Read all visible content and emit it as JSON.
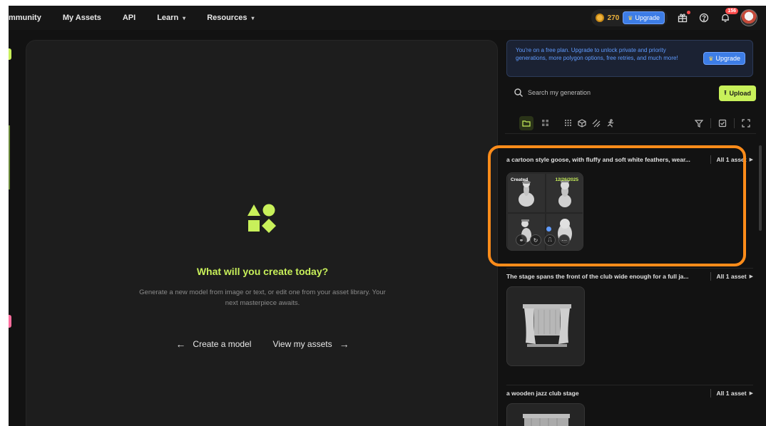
{
  "nav": {
    "items": [
      {
        "label": "mmunity",
        "has_caret": false
      },
      {
        "label": "My Assets",
        "has_caret": false
      },
      {
        "label": "API",
        "has_caret": false
      },
      {
        "label": "Learn",
        "has_caret": true
      },
      {
        "label": "Resources",
        "has_caret": true
      }
    ],
    "caret_glyph": "▾",
    "credits": "270",
    "upgrade_label": "Upgrade",
    "notification_badge": "156",
    "icons": [
      "coin-icon",
      "crown-icon",
      "gift-icon",
      "help-icon",
      "bell-icon",
      "avatar"
    ]
  },
  "hero": {
    "title": "What will you create today?",
    "subtitle": "Generate a new model from image or text, or edit one from your asset library. Your next masterpiece awaits.",
    "create_label": "Create a model",
    "view_label": "View my assets"
  },
  "promo": {
    "text": "You're on a free plan. Upgrade to unlock private and priority generations, more polygon options, free retries, and much more!",
    "button_label": "Upgrade"
  },
  "search": {
    "placeholder": "Search my generation",
    "upload_label": "Upload"
  },
  "groups": [
    {
      "title": "a cartoon style goose, with fluffy and soft white feathers, wear...",
      "count": "All 1 asset"
    },
    {
      "title": "The stage spans the front of the club wide enough for a full ja...",
      "count": "All 1 asset"
    },
    {
      "title": "a wooden jazz club stage",
      "count": "All 1 asset"
    }
  ],
  "goose_card": {
    "label_left": "Created",
    "label_right": "12/26/2025"
  },
  "colors": {
    "accent": "#c8f05a",
    "highlight": "#ff8c1a",
    "upgrade_blue": "#3d7de6"
  }
}
